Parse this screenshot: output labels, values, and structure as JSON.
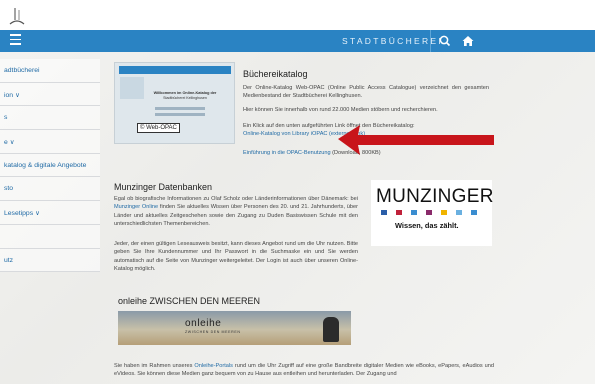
{
  "header": {
    "brand": "STADTBÜCHEREI",
    "colors": {
      "nav": "#2a83c3",
      "link": "#1f6aa5"
    }
  },
  "sidebar": {
    "items": [
      {
        "label": "adtbücherei",
        "chevron": false
      },
      {
        "label": "ion",
        "chevron": true
      },
      {
        "label": "s",
        "chevron": false
      },
      {
        "label": "e",
        "chevron": true
      },
      {
        "label": "katalog & digitale Angebote",
        "chevron": false
      },
      {
        "label": "sto",
        "chevron": false
      },
      {
        "label": "Lesetipps",
        "chevron": true
      },
      {
        "label": "",
        "chevron": false
      },
      {
        "label": "utz",
        "chevron": false
      }
    ]
  },
  "catalog": {
    "thumb_title1": "Willkommen im Online-Katalog der",
    "thumb_title2": "Stadtbücherei Kellinghusen",
    "thumb_badge": "© Web-OPAC",
    "thumb_header": "KELLINGHUSEN",
    "heading": "Büchereikatalog",
    "p1": "Der Online-Katalog Web-OPAC (Online Public Access Catalogue) verzeichnet den gesamten Medienbestand der Stadtbücherei Kellinghusen.",
    "p2": "Hier können Sie innerhalb von rund 22.000 Medien stöbern und recherchieren.",
    "p3": "Ein Klick auf den unten aufgeführten Link öffnet den Büchereikatalog:",
    "link1": "Online-Katalog von Library iOPAC (externer Link)",
    "link2": "Einführung in die OPAC-Benutzung",
    "link2_suffix": " (Download, 800KB)"
  },
  "munzinger": {
    "heading": "Munzinger Datenbanken",
    "p1_a": "Egal ob biografische Informationen zu Olaf Scholz oder Länderinformationen über Dänemark: bei ",
    "p1_link": "Munzinger Online",
    "p1_b": " finden Sie aktuelles Wissen über Personen des 20. und 21. Jahrhunderts, über Länder und aktuelles Zeitgeschehen sowie den Zugang zu Duden Basiswissen Schule mit den unterschiedlichsten Themenbereichen.",
    "p2": "Jeder, der einen gültigen Leseausweis besitzt, kann dieses Angebot rund um die Uhr nutzen. Bitte geben Sie Ihre Kundennummer und Ihr Passwort in die Suchmaske ein und Sie werden automatisch auf die Seite von Munzinger weitergeleitet. Der Login ist auch über unseren Online-Katalog möglich.",
    "logo_word": "MUNZINGER",
    "logo_slogan": "Wissen, das zählt.",
    "dot_colors": [
      "#2a5ea8",
      "#c0213a",
      "#3a8dd0",
      "#8a2a6a",
      "#f0b400",
      "#6ab0e0",
      "#3a8dd0"
    ]
  },
  "onleihe": {
    "heading": "onleihe ZWISCHEN DEN MEEREN",
    "banner_word": "onleihe",
    "banner_sub": "ZWISCHEN DEN MEEREN",
    "p1_a": "Sie haben im Rahmen unseres ",
    "p1_link": "Onleihe-Portals",
    "p1_b": " rund um die Uhr Zugriff auf eine große Bandbreite digitaler Medien wie eBooks, ePapers, eAudios und eVideos. Sie können diese Medien ganz bequem von zu Hause aus entleihen und herunterladen. Der Zugang und"
  }
}
